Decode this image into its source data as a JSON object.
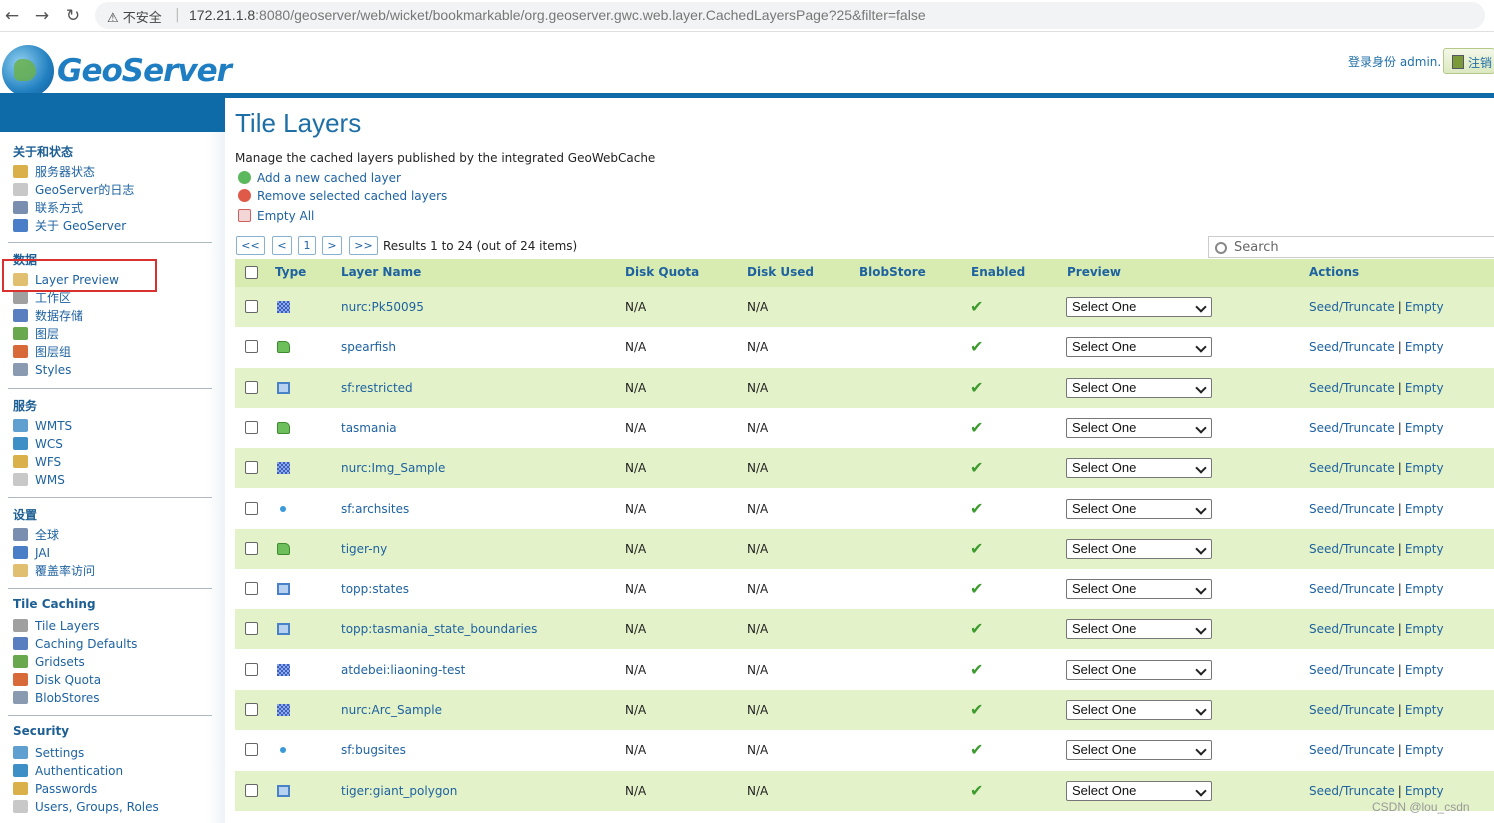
{
  "browser": {
    "insecure_label": "不安全",
    "url_host": "172.21.1.8",
    "url_rest": ":8080/geoserver/web/wicket/bookmarkable/org.geoserver.gwc.web.layer.CachedLayersPage?25&filter=false"
  },
  "header": {
    "brand": "GeoServer",
    "login_text": "登录身份 admin.",
    "logout_label": "注销"
  },
  "sidebar": {
    "sections": [
      {
        "title": "关于和状态",
        "items": [
          {
            "label": "服务器状态",
            "icon": "server-status-icon"
          },
          {
            "label": "GeoServer的日志",
            "icon": "log-icon"
          },
          {
            "label": "联系方式",
            "icon": "contact-icon"
          },
          {
            "label": "关于 GeoServer",
            "icon": "about-icon"
          }
        ]
      },
      {
        "title": "数据",
        "items": [
          {
            "label": "Layer Preview",
            "icon": "layer-preview-icon"
          },
          {
            "label": "工作区",
            "icon": "workspace-icon"
          },
          {
            "label": "数据存储",
            "icon": "datastore-icon"
          },
          {
            "label": "图层",
            "icon": "layers-icon"
          },
          {
            "label": "图层组",
            "icon": "layer-group-icon"
          },
          {
            "label": "Styles",
            "icon": "styles-icon"
          }
        ]
      },
      {
        "title": "服务",
        "items": [
          {
            "label": "WMTS",
            "icon": "service-icon"
          },
          {
            "label": "WCS",
            "icon": "service-icon"
          },
          {
            "label": "WFS",
            "icon": "service-icon"
          },
          {
            "label": "WMS",
            "icon": "service-icon"
          }
        ]
      },
      {
        "title": "设置",
        "items": [
          {
            "label": "全球",
            "icon": "global-icon"
          },
          {
            "label": "JAI",
            "icon": "jai-icon"
          },
          {
            "label": "覆盖率访问",
            "icon": "coverage-access-icon"
          }
        ]
      },
      {
        "title": "Tile Caching",
        "items": [
          {
            "label": "Tile Layers",
            "icon": "tile-layers-icon"
          },
          {
            "label": "Caching Defaults",
            "icon": "caching-defaults-icon"
          },
          {
            "label": "Gridsets",
            "icon": "gridsets-icon"
          },
          {
            "label": "Disk Quota",
            "icon": "disk-quota-icon"
          },
          {
            "label": "BlobStores",
            "icon": "blobstores-icon"
          }
        ]
      },
      {
        "title": "Security",
        "items": [
          {
            "label": "Settings",
            "icon": "settings-icon"
          },
          {
            "label": "Authentication",
            "icon": "authentication-icon"
          },
          {
            "label": "Passwords",
            "icon": "passwords-icon"
          },
          {
            "label": "Users, Groups, Roles",
            "icon": "users-icon"
          }
        ]
      }
    ]
  },
  "page": {
    "title": "Tile Layers",
    "description": "Manage the cached layers published by the integrated GeoWebCache",
    "actions": {
      "add": "Add a new cached layer",
      "remove": "Remove selected cached layers",
      "empty_all": "Empty All"
    },
    "pager": {
      "first": "<<",
      "prev": "<",
      "current": "1",
      "next": ">",
      "last": ">>",
      "results": "Results 1 to 24 (out of 24 items)"
    },
    "search_placeholder": "Search"
  },
  "table": {
    "headers": {
      "type": "Type",
      "layer_name": "Layer Name",
      "disk_quota": "Disk Quota",
      "disk_used": "Disk Used",
      "blobstore": "BlobStore",
      "enabled": "Enabled",
      "preview": "Preview",
      "actions": "Actions"
    },
    "select_label": "Select One",
    "seed_label": "Seed/Truncate",
    "empty_label": "Empty",
    "rows": [
      {
        "type": "raster",
        "name": "nurc:Pk50095",
        "disk_quota": "N/A",
        "disk_used": "N/A",
        "enabled": "✔"
      },
      {
        "type": "poly",
        "name": "spearfish",
        "disk_quota": "N/A",
        "disk_used": "N/A",
        "enabled": "✔"
      },
      {
        "type": "line",
        "name": "sf:restricted",
        "disk_quota": "N/A",
        "disk_used": "N/A",
        "enabled": "✔"
      },
      {
        "type": "poly",
        "name": "tasmania",
        "disk_quota": "N/A",
        "disk_used": "N/A",
        "enabled": "✔"
      },
      {
        "type": "raster",
        "name": "nurc:Img_Sample",
        "disk_quota": "N/A",
        "disk_used": "N/A",
        "enabled": "✔"
      },
      {
        "type": "point",
        "name": "sf:archsites",
        "disk_quota": "N/A",
        "disk_used": "N/A",
        "enabled": "✔"
      },
      {
        "type": "poly",
        "name": "tiger-ny",
        "disk_quota": "N/A",
        "disk_used": "N/A",
        "enabled": "✔"
      },
      {
        "type": "line",
        "name": "topp:states",
        "disk_quota": "N/A",
        "disk_used": "N/A",
        "enabled": "✔"
      },
      {
        "type": "line",
        "name": "topp:tasmania_state_boundaries",
        "disk_quota": "N/A",
        "disk_used": "N/A",
        "enabled": "✔"
      },
      {
        "type": "raster",
        "name": "atdebei:liaoning-test",
        "disk_quota": "N/A",
        "disk_used": "N/A",
        "enabled": "✔"
      },
      {
        "type": "raster",
        "name": "nurc:Arc_Sample",
        "disk_quota": "N/A",
        "disk_used": "N/A",
        "enabled": "✔"
      },
      {
        "type": "point",
        "name": "sf:bugsites",
        "disk_quota": "N/A",
        "disk_used": "N/A",
        "enabled": "✔"
      },
      {
        "type": "line",
        "name": "tiger:giant_polygon",
        "disk_quota": "N/A",
        "disk_used": "N/A",
        "enabled": "✔"
      }
    ]
  },
  "watermark": "CSDN @lou_csdn"
}
